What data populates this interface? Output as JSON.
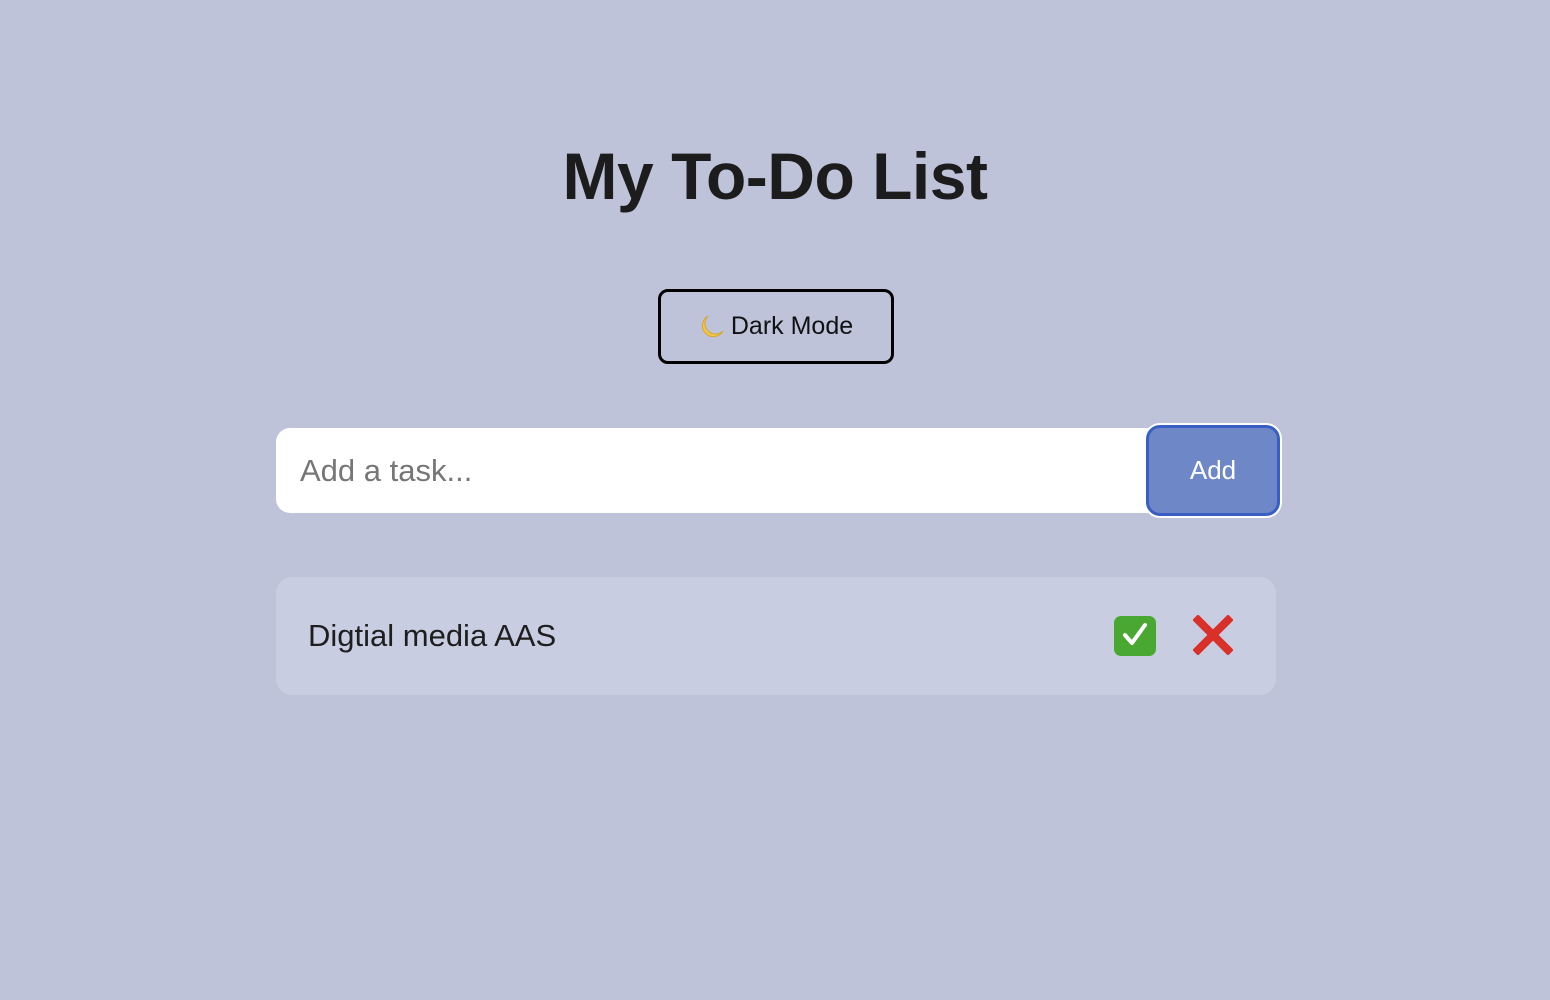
{
  "header": {
    "title": "My To-Do List"
  },
  "theme_toggle": {
    "icon": "crescent-moon-icon",
    "label": "Dark Mode"
  },
  "add_task": {
    "value": "",
    "placeholder": "Add a task...",
    "button_label": "Add"
  },
  "tasks": [
    {
      "text": "Digtial media AAS",
      "complete_icon": "check-mark-icon",
      "delete_icon": "cross-mark-icon"
    }
  ],
  "colors": {
    "background": "#bec3da",
    "add_button": "#6d87c7",
    "task_row": "#c9cde1",
    "check_green": "#49a832",
    "cross_red": "#d9302a"
  }
}
